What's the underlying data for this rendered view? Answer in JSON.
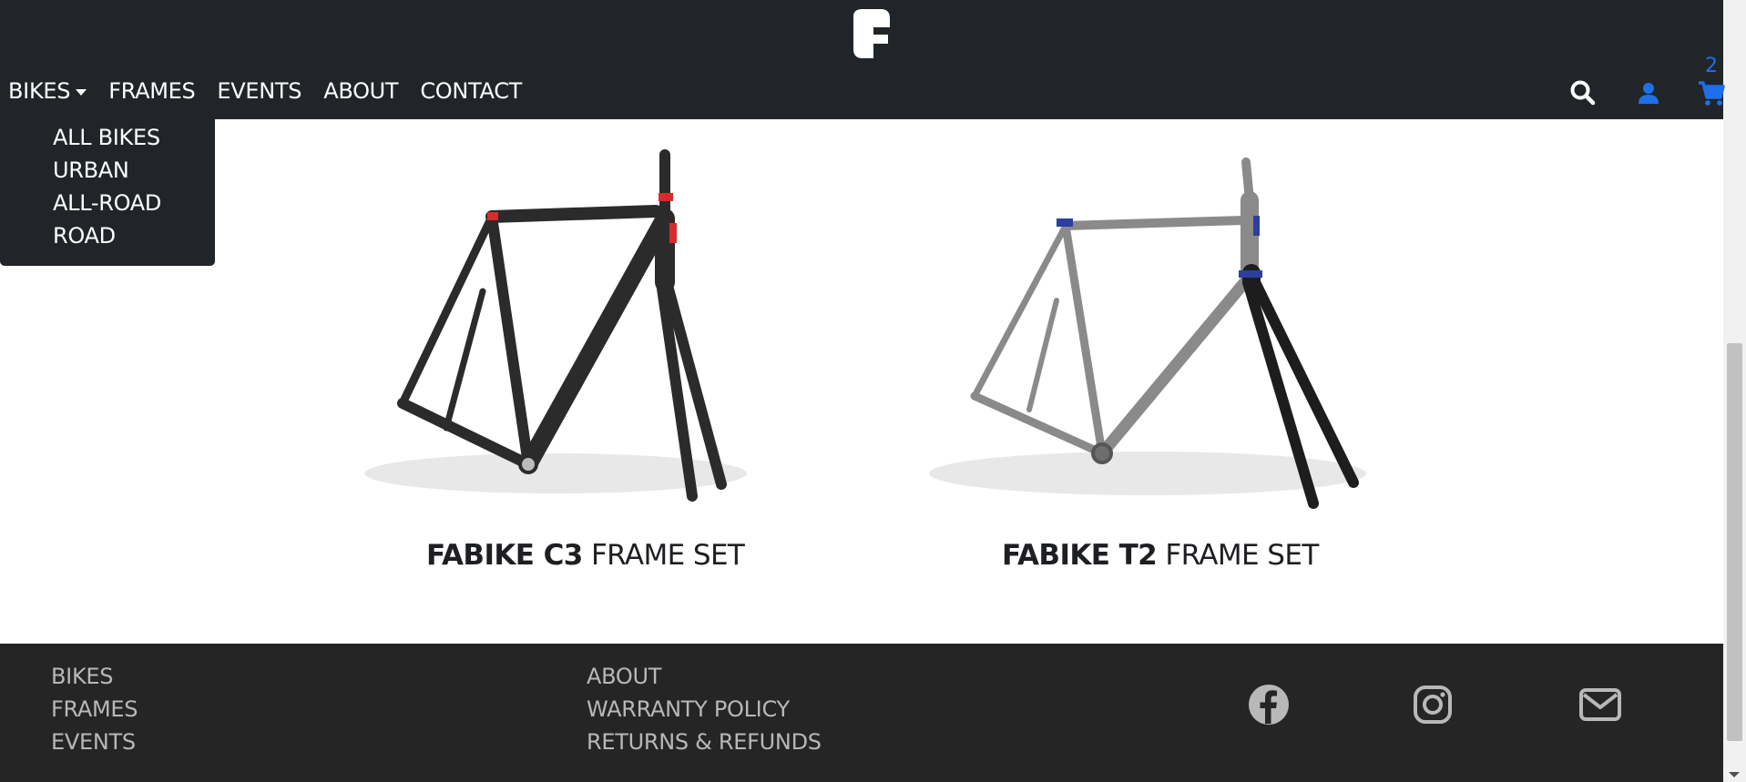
{
  "header": {
    "logo_icon": "fabike-logo-icon",
    "nav": [
      {
        "label": "BIKES",
        "dropdown": true
      },
      {
        "label": "FRAMES"
      },
      {
        "label": "EVENTS"
      },
      {
        "label": "ABOUT"
      },
      {
        "label": "CONTACT"
      }
    ],
    "icons": {
      "search": "search-icon",
      "account": "user-icon",
      "cart": "cart-icon"
    },
    "cart_count": "2",
    "accent_color": "#1f6feb",
    "background_color": "#212529"
  },
  "bikes_menu": {
    "items": [
      "ALL BIKES",
      "URBAN",
      "ALL-ROAD",
      "ROAD"
    ]
  },
  "products": [
    {
      "name": "FABIKE C3",
      "suffix": "FRAME SET",
      "frame_color": "#2b2b2b",
      "accent_color": "#d92b2b"
    },
    {
      "name": "FABIKE T2",
      "suffix": "FRAME SET",
      "frame_color": "#8a8a8a",
      "accent_color": "#2c3f9c"
    }
  ],
  "footer": {
    "col1": [
      "BIKES",
      "FRAMES",
      "EVENTS"
    ],
    "col2": [
      "ABOUT",
      "WARRANTY POLICY",
      "RETURNS & REFUNDS"
    ],
    "social": [
      "facebook-icon",
      "instagram-icon",
      "email-icon"
    ]
  }
}
